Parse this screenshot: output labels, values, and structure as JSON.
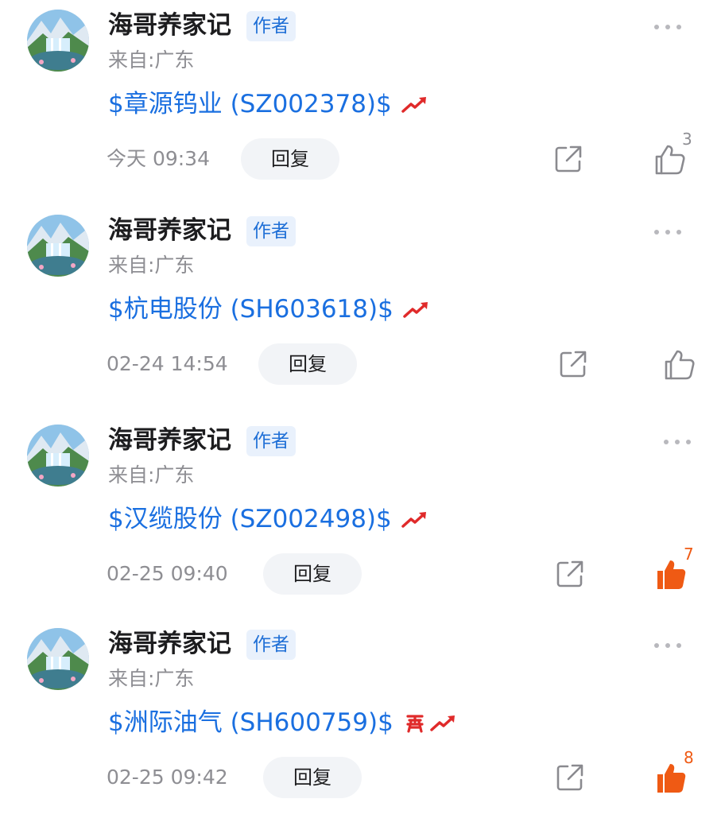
{
  "posts": [
    {
      "author": "海哥养家记",
      "badge": "作者",
      "location": "来自:广东",
      "stock": "$章源钨业 (SZ002378)$",
      "time": "今天 09:34",
      "reply_label": "回复",
      "likes": "3",
      "liked": false,
      "has_buy_badge": false
    },
    {
      "author": "海哥养家记",
      "badge": "作者",
      "location": "来自:广东",
      "stock": "$杭电股份 (SH603618)$",
      "time": "02-24 14:54",
      "reply_label": "回复",
      "likes": "",
      "liked": false,
      "has_buy_badge": false
    },
    {
      "author": "海哥养家记",
      "badge": "作者",
      "location": "来自:广东",
      "stock": "$汉缆股份 (SZ002498)$",
      "time": "02-25 09:40",
      "reply_label": "回复",
      "likes": "7",
      "liked": true,
      "has_buy_badge": false
    },
    {
      "author": "海哥养家记",
      "badge": "作者",
      "location": "来自:广东",
      "stock": "$洲际油气 (SH600759)$",
      "time": "02-25 09:42",
      "reply_label": "回复",
      "likes": "8",
      "liked": true,
      "has_buy_badge": true
    }
  ],
  "icons": {
    "more": "more-dots-icon",
    "trend": "trend-up-icon",
    "buy": "buy-badge-icon",
    "share": "share-icon",
    "like": "thumbs-up-icon"
  },
  "colors": {
    "link": "#1a6fe0",
    "badge_bg": "#e9f1fc",
    "badge_text": "#1f6fd6",
    "meta_gray": "#8e8e93",
    "liked_orange": "#ef5a14",
    "trend_red": "#e02a2a",
    "reply_bg": "#f2f4f7"
  }
}
